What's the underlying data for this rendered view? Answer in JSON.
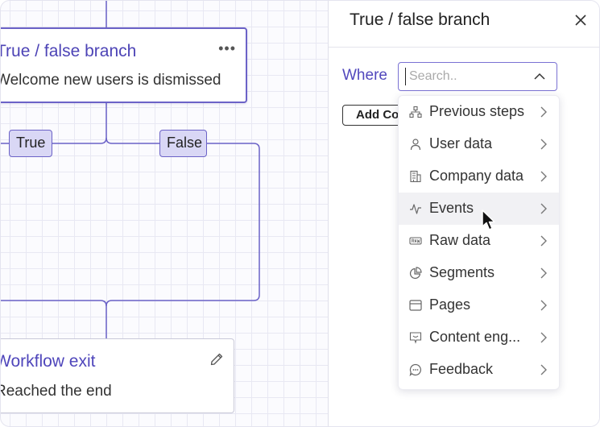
{
  "canvas": {
    "branch_node": {
      "title": "True / false branch",
      "subtitle": "Welcome new users is dismissed",
      "more_icon": "more-horizontal-icon"
    },
    "pills": {
      "true_label": "True",
      "false_label": "False"
    },
    "exit_node": {
      "title": "Workflow exit",
      "subtitle": "Reached the end",
      "edit_icon": "pencil-icon"
    },
    "colors": {
      "accent": "#5a50c0",
      "pill_fill": "#d9d7f5",
      "wire": "#6b62c7"
    }
  },
  "panel": {
    "title": "True / false branch",
    "close_icon": "close-icon",
    "where_label": "Where",
    "search": {
      "value": "",
      "placeholder": "Search.."
    },
    "add_button": "Add Co",
    "menu": [
      {
        "label": "Previous steps",
        "icon": "flow-icon"
      },
      {
        "label": "User data",
        "icon": "user-icon"
      },
      {
        "label": "Company data",
        "icon": "building-icon"
      },
      {
        "label": "Events",
        "icon": "activity-icon",
        "active": true
      },
      {
        "label": "Raw data",
        "icon": "raw-icon"
      },
      {
        "label": "Segments",
        "icon": "pie-icon"
      },
      {
        "label": "Pages",
        "icon": "browser-icon"
      },
      {
        "label": "Content eng...",
        "icon": "content-icon"
      },
      {
        "label": "Feedback",
        "icon": "chat-icon"
      }
    ]
  }
}
